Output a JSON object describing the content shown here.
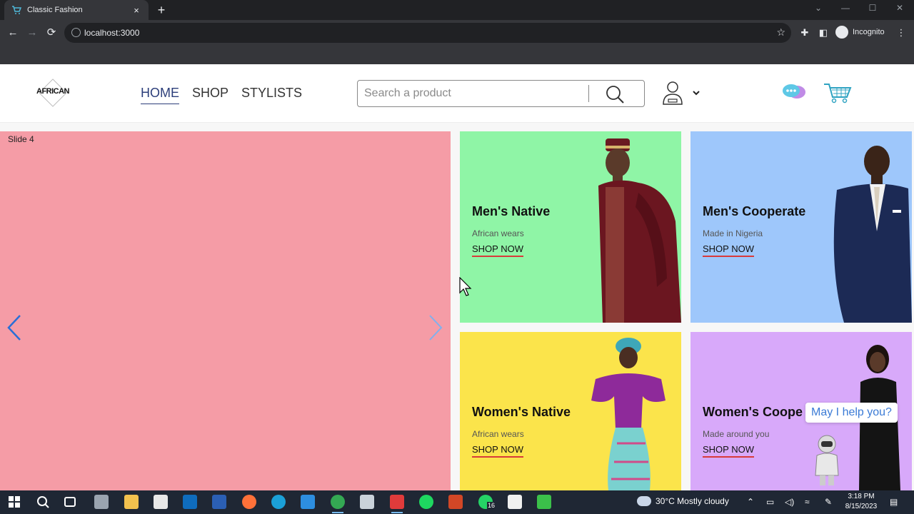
{
  "browser": {
    "tab_title": "Classic Fashion",
    "tab_close": "×",
    "new_tab": "+",
    "url": "localhost:3000",
    "profile_label": "Incognito",
    "window_controls": [
      "minimize",
      "maximize",
      "close"
    ]
  },
  "header": {
    "logo_text": "AFRICAN",
    "nav": [
      {
        "label": "HOME",
        "active": true
      },
      {
        "label": "SHOP",
        "active": false
      },
      {
        "label": "STYLISTS",
        "active": false
      }
    ],
    "search": {
      "placeholder": "Search a product"
    }
  },
  "slider": {
    "label": "Slide 4",
    "background": "#f59ca6"
  },
  "cards": [
    {
      "title": "Men's Native",
      "subtitle": "African wears",
      "cta": "SHOP NOW",
      "background": "#8ff5a6"
    },
    {
      "title": "Men's Cooperate",
      "subtitle": "Made in Nigeria",
      "cta": "SHOP NOW",
      "background": "#9ec7fb"
    },
    {
      "title": "Women's Native",
      "subtitle": "African wears",
      "cta": "SHOP NOW",
      "background": "#fbe44b"
    },
    {
      "title": "Women's Coope",
      "subtitle": "Made around you",
      "cta": "SHOP NOW",
      "background": "#d8a9fa"
    }
  ],
  "help_bubble": "May I help you?",
  "taskbar": {
    "weather": "30°C  Mostly cloudy",
    "whatsapp_badge": "16",
    "time": "3:18 PM",
    "date": "8/15/2023"
  },
  "colors": {
    "accent_underline": "#d83a3a",
    "nav_active": "#2c3e7a"
  }
}
